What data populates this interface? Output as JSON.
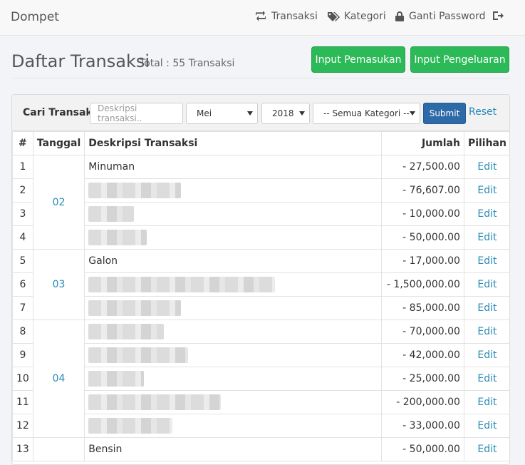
{
  "nav": {
    "brand": "Dompet",
    "items": [
      {
        "label": "Transaksi",
        "icon": "retweet-icon"
      },
      {
        "label": "Kategori",
        "icon": "tags-icon"
      },
      {
        "label": "Ganti Password",
        "icon": "lock-icon"
      },
      {
        "label": "",
        "icon": "logout-icon"
      }
    ]
  },
  "header": {
    "title": "Daftar Transaksi",
    "subtitle": "Total : 55 Transaksi",
    "btn_income": "Input Pemasukan",
    "btn_expense": "Input Pengeluaran"
  },
  "filter": {
    "label": "Cari Transaksi",
    "search_placeholder": "Deskripsi transaksi..",
    "month": "Mei",
    "year": "2018",
    "category": "-- Semua Kategori --",
    "submit": "Submit",
    "reset": "Reset"
  },
  "table": {
    "columns": [
      "#",
      "Tanggal",
      "Deskripsi Transaksi",
      "Jumlah",
      "Pilihan"
    ],
    "groups": [
      {
        "date": "02",
        "rows": [
          {
            "no": "1",
            "desc": "Minuman",
            "amount": "- 27,500.00",
            "action": "Edit"
          },
          {
            "no": "2",
            "desc": "",
            "amount": "- 76,607.00",
            "action": "Edit"
          },
          {
            "no": "3",
            "desc": "",
            "amount": "- 10,000.00",
            "action": "Edit"
          },
          {
            "no": "4",
            "desc": "",
            "amount": "- 50,000.00",
            "action": "Edit"
          }
        ]
      },
      {
        "date": "03",
        "rows": [
          {
            "no": "5",
            "desc": "Galon",
            "amount": "- 17,000.00",
            "action": "Edit"
          },
          {
            "no": "6",
            "desc": "",
            "amount": "- 1,500,000.00",
            "action": "Edit"
          },
          {
            "no": "7",
            "desc": "",
            "amount": "- 85,000.00",
            "action": "Edit"
          }
        ]
      },
      {
        "date": "04",
        "rows": [
          {
            "no": "8",
            "desc": "",
            "amount": "- 70,000.00",
            "action": "Edit"
          },
          {
            "no": "9",
            "desc": "",
            "amount": "- 42,000.00",
            "action": "Edit"
          },
          {
            "no": "10",
            "desc": "",
            "amount": "- 25,000.00",
            "action": "Edit"
          },
          {
            "no": "11",
            "desc": "",
            "amount": "- 200,000.00",
            "action": "Edit"
          },
          {
            "no": "12",
            "desc": "",
            "amount": "- 33,000.00",
            "action": "Edit"
          }
        ]
      },
      {
        "date": "",
        "rows": [
          {
            "no": "13",
            "desc": "Bensin",
            "amount": "- 50,000.00",
            "action": "Edit"
          }
        ]
      }
    ]
  }
}
